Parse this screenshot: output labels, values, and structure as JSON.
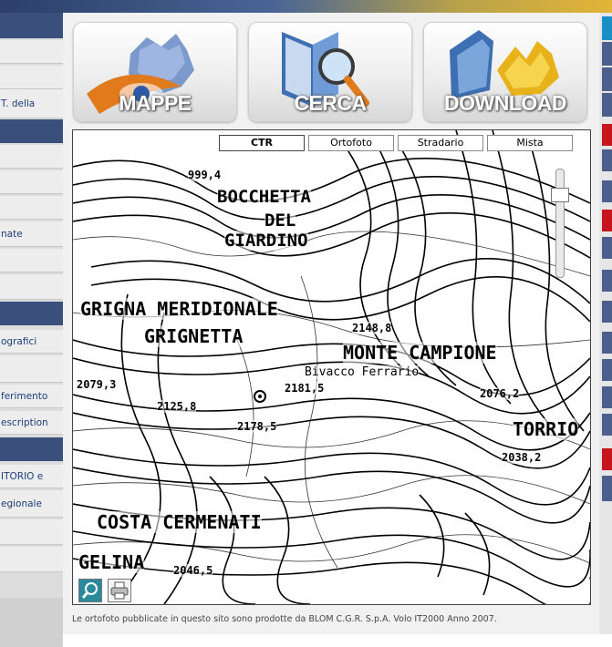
{
  "sidebar": {
    "items": [
      {
        "label": "",
        "type": "hdr"
      },
      {
        "label": "",
        "type": "item"
      },
      {
        "label": "",
        "type": "item"
      },
      {
        "label": "T. della",
        "type": "item"
      },
      {
        "label": "",
        "type": "hdr"
      },
      {
        "label": "",
        "type": "item"
      },
      {
        "label": "",
        "type": "item"
      },
      {
        "label": "",
        "type": "item"
      },
      {
        "label": "nate",
        "type": "item"
      },
      {
        "label": "",
        "type": "item"
      },
      {
        "label": "",
        "type": "item"
      },
      {
        "label": "",
        "type": "hdr"
      },
      {
        "label": "ografici",
        "type": "item"
      },
      {
        "label": "",
        "type": "item"
      },
      {
        "label": "ferimento",
        "type": "item"
      },
      {
        "label": "escription",
        "type": "item"
      },
      {
        "label": "",
        "type": "hdr"
      },
      {
        "label": "ITORIO e",
        "type": "item"
      },
      {
        "label": "egionale",
        "type": "item"
      },
      {
        "label": "",
        "type": "item"
      },
      {
        "label": "",
        "type": "item"
      }
    ]
  },
  "nav": {
    "mappe": "MAPPE",
    "cerca": "CERCA",
    "download": "DOWNLOAD"
  },
  "map": {
    "tabs": [
      "CTR",
      "Ortofoto",
      "Stradario",
      "Mista"
    ],
    "active_tab": "CTR",
    "labels": [
      {
        "text": "999,4"
      },
      {
        "text": "BOCCHETTA"
      },
      {
        "text": "DEL"
      },
      {
        "text": "GIARDINO"
      },
      {
        "text": "GRIGNA  MERIDIONALE"
      },
      {
        "text": "GRIGNETTA"
      },
      {
        "text": "2148,8"
      },
      {
        "text": "MONTE  CAMPIONE"
      },
      {
        "text": "Bivacco Ferrario"
      },
      {
        "text": "2079,3"
      },
      {
        "text": "2125,8"
      },
      {
        "text": "2181,5"
      },
      {
        "text": "2076,2"
      },
      {
        "text": "2178,5"
      },
      {
        "text": "TORRIO"
      },
      {
        "text": "2038,2"
      },
      {
        "text": "COSTA  CERMENATI"
      },
      {
        "text": "GELINA"
      },
      {
        "text": "2046,5"
      }
    ],
    "tools": {
      "search_icon": "magnifier-icon",
      "print_icon": "printer-icon"
    }
  },
  "caption": "Le ortofoto pubblicate in questo sito sono prodotte da BLOM C.G.R. S.p.A. Volo IT2000 Anno 2007.",
  "colors": {
    "sidebar_header": "#3a4f7c",
    "sidebar_link": "#1d3c7a",
    "accent_red": "#c4161c",
    "accent_blue": "#4a5f8c"
  }
}
